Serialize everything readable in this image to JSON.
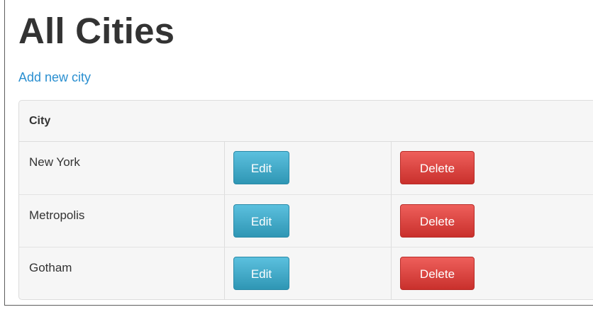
{
  "page": {
    "title": "All Cities",
    "add_link": "Add new city"
  },
  "table": {
    "header": "City",
    "rows": [
      {
        "city": "New York",
        "edit_label": "Edit",
        "delete_label": "Delete"
      },
      {
        "city": "Metropolis",
        "edit_label": "Edit",
        "delete_label": "Delete"
      },
      {
        "city": "Gotham",
        "edit_label": "Edit",
        "delete_label": "Delete"
      }
    ]
  },
  "colors": {
    "link": "#2a8fd0",
    "edit_button": "#2f96b4",
    "delete_button": "#c9302c",
    "title_text": "#333333"
  }
}
